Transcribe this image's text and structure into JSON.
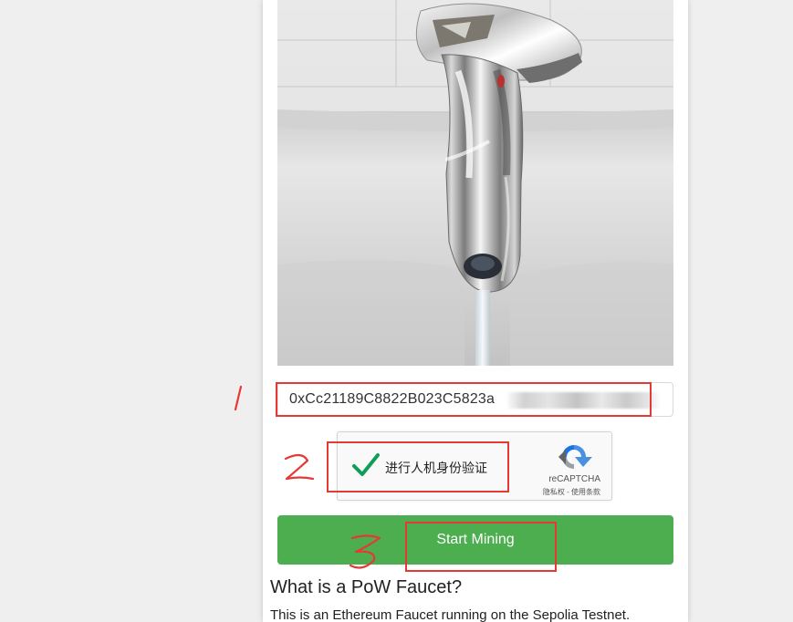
{
  "address_field": {
    "value": "0xCc21189C8822B023C5823a",
    "obscured_tail_visible": false
  },
  "recaptcha": {
    "label": "进行人机身份验证",
    "brand": "reCAPTCHA",
    "links": "隐私权 - 使用条款",
    "checked": true
  },
  "actions": {
    "start_mining_label": "Start Mining"
  },
  "info": {
    "title": "What is a PoW Faucet?",
    "text": "This is an Ethereum Faucet running on the Sepolia Testnet."
  },
  "annotations": {
    "marks": [
      "1",
      "2",
      "3"
    ],
    "color": "#e53935"
  },
  "colors": {
    "button": "#4cae4f",
    "check": "#0f9d58",
    "page_bg": "#efefef"
  }
}
